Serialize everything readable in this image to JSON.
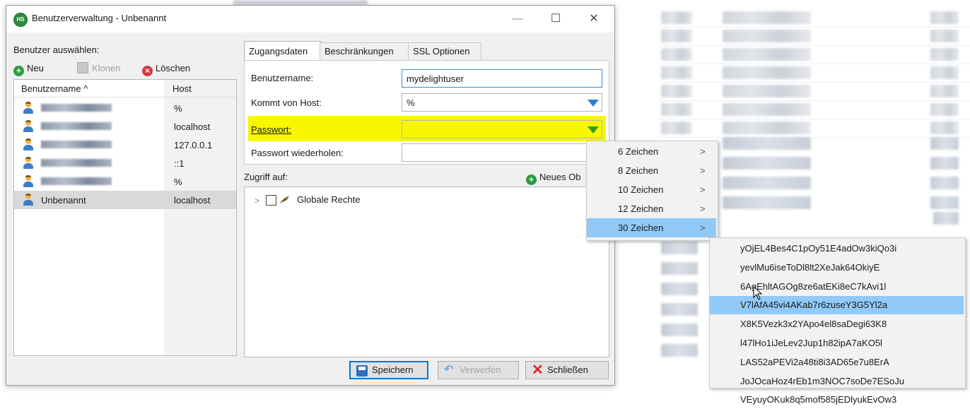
{
  "dialog": {
    "title": "Benutzerverwaltung - Unbenannt",
    "logo": "HS",
    "window_controls": [
      "—",
      "☐",
      "✕"
    ]
  },
  "sidebar": {
    "label": "Benutzer auswählen:",
    "toolbar": {
      "new": "Neu",
      "clone": "Klonen",
      "delete": "Löschen"
    },
    "columns": {
      "user": "Benutzername ^",
      "host": "Host"
    },
    "users": [
      {
        "name": "",
        "host": "%"
      },
      {
        "name": "",
        "host": "localhost"
      },
      {
        "name": "",
        "host": "127.0.0.1"
      },
      {
        "name": "",
        "host": "::1"
      },
      {
        "name": "",
        "host": "%"
      },
      {
        "name": "Unbenannt",
        "host": "localhost"
      }
    ]
  },
  "tabs": [
    "Zugangsdaten",
    "Beschränkungen",
    "SSL Optionen"
  ],
  "form": {
    "username_label": "Benutzername:",
    "username_value": "mydelightuser",
    "host_label": "Kommt von Host:",
    "host_value": "%",
    "password_label": "Passwort:",
    "password_value": "",
    "password_repeat_label": "Passwort wiederholen:",
    "password_repeat_value": ""
  },
  "access": {
    "label": "Zugriff auf:",
    "new_object": "Neues Ob",
    "tree_items": [
      {
        "arrow": ">",
        "label": "Globale Rechte"
      }
    ]
  },
  "buttons": {
    "save": "Speichern",
    "discard": "Verwerfen",
    "close": "Schließen"
  },
  "length_menu": {
    "items": [
      {
        "label": "6 Zeichen",
        "arrow": ">"
      },
      {
        "label": "8 Zeichen",
        "arrow": ">"
      },
      {
        "label": "10 Zeichen",
        "arrow": ">"
      },
      {
        "label": "12 Zeichen",
        "arrow": ">"
      },
      {
        "label": "30 Zeichen",
        "arrow": ">"
      }
    ],
    "highlighted": "30 Zeichen"
  },
  "password_menu": {
    "items": [
      "yOjEL4Bes4C1pOy51E4adOw3kiQo3i",
      "yevlMu6iseToDl8lt2XeJak64OkiyE",
      "6AgEhltAGOg8ze6atEKi8eC7kAvi1l",
      "V7lAfA45vi4AKab7r6zuseY3G5Yl2a",
      "X8K5Vezk3x2YApo4el8saDegi63K8",
      "l47lHo1iJeLev2Jup1h82ipA7aKO5l",
      "LAS52aPEVi2a48ti8i3AD65e7u8ErA",
      "JoJOcaHoz4rEb1m3NOC7soDe7ESoJu",
      "VEyuyOKuk8q5mof585jEDlyukEvOw3"
    ],
    "highlighted": "V7lAfA45vi4AKab7r6zuseY3G5Yl2a"
  },
  "colors": {
    "highlight_yellow": "#f8f700",
    "menu_highlight": "#91c9f7",
    "selection": "#d9d9d9",
    "accent_blue": "#0078d7"
  },
  "icons": {
    "new": "plus-circle-icon",
    "clone": "clone-icon",
    "delete": "delete-circle-icon",
    "user": "user-icon",
    "save": "floppy-icon",
    "discard": "undo-icon",
    "close": "x-icon"
  }
}
